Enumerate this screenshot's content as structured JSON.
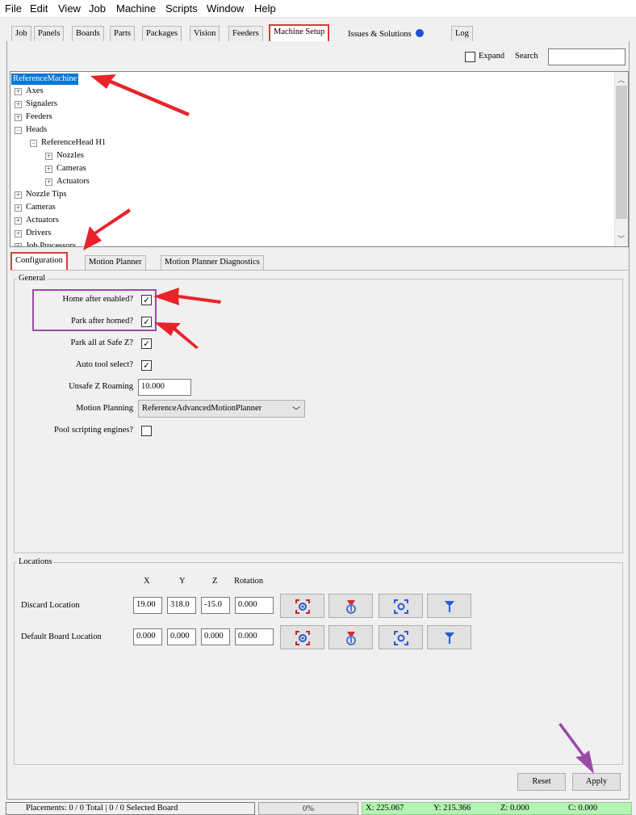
{
  "menu": [
    "File",
    "Edit",
    "View",
    "Job",
    "Machine",
    "Scripts",
    "Window",
    "Help"
  ],
  "main_tabs": [
    {
      "label": "Job"
    },
    {
      "label": "Panels"
    },
    {
      "label": "Boards"
    },
    {
      "label": "Parts"
    },
    {
      "label": "Packages"
    },
    {
      "label": "Vision"
    },
    {
      "label": "Feeders"
    },
    {
      "label": "Machine Setup",
      "selected": true
    },
    {
      "label": "Issues & Solutions"
    },
    {
      "label": "Log"
    }
  ],
  "search": {
    "expand_label": "Expand",
    "search_label": "Search",
    "value": ""
  },
  "tree": {
    "root": "ReferenceMachine",
    "items": [
      "Axes",
      "Signalers",
      "Feeders",
      "Heads",
      "ReferenceHead H1",
      "Nozzles",
      "Cameras",
      "Actuators",
      "Nozzle Tips",
      "Cameras",
      "Actuators",
      "Drivers",
      "Job Processors"
    ]
  },
  "sub_tabs": [
    {
      "label": "Configuration",
      "selected": true
    },
    {
      "label": "Motion Planner"
    },
    {
      "label": "Motion Planner Diagnostics"
    }
  ],
  "general": {
    "title": "General",
    "home_after_enabled": {
      "label": "Home after enabled?",
      "checked": true
    },
    "park_after_homed": {
      "label": "Park after homed?",
      "checked": true
    },
    "park_all_safe_z": {
      "label": "Park all at Safe Z?",
      "checked": true
    },
    "auto_tool_select": {
      "label": "Auto tool select?",
      "checked": true
    },
    "unsafe_z_roaming": {
      "label": "Unsafe Z Roaming",
      "value": "10.000"
    },
    "motion_planning": {
      "label": "Motion Planning",
      "value": "ReferenceAdvancedMotionPlanner"
    },
    "pool_scripting": {
      "label": "Pool scripting engines?",
      "checked": false
    }
  },
  "locations": {
    "title": "Locations",
    "headers": [
      "X",
      "Y",
      "Z",
      "Rotation"
    ],
    "rows": [
      {
        "label": "Discard Location",
        "x": "19.00",
        "y": "318.0",
        "z": "-15.0",
        "rotation": "0.000"
      },
      {
        "label": "Default Board Location",
        "x": "0.000",
        "y": "0.000",
        "z": "0.000",
        "rotation": "0.000"
      }
    ]
  },
  "buttons": {
    "reset": "Reset",
    "apply": "Apply"
  },
  "status": {
    "placements": "Placements: 0 / 0 Total | 0 / 0 Selected Board",
    "progress": "0%",
    "progress_value": 0,
    "x": "X: 225.067",
    "y": "Y: 215.366",
    "z": "Z: 0.000",
    "c": "C: 0.000"
  },
  "colors": {
    "accent": "#0078d7",
    "annotation_red": "#e8232a",
    "annotation_purple": "#9b4aa8",
    "status_green": "#b3f3b3"
  }
}
